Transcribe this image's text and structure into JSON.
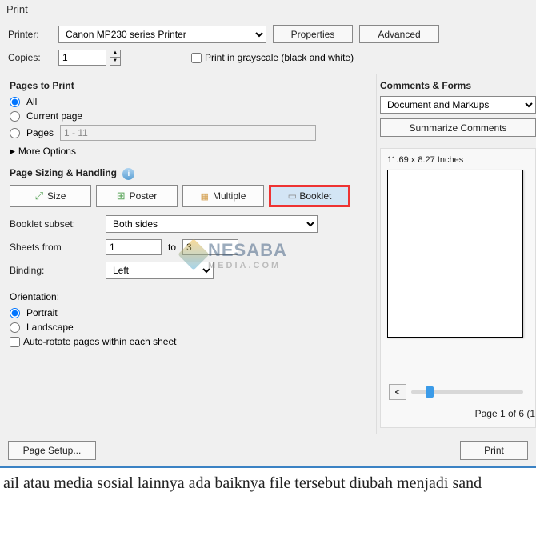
{
  "title": "Print",
  "printer": {
    "label": "Printer:",
    "value": "Canon MP230 series Printer"
  },
  "buttons": {
    "properties": "Properties",
    "advanced": "Advanced",
    "summarize": "Summarize Comments",
    "pagesetup": "Page Setup...",
    "print": "Print"
  },
  "copies": {
    "label": "Copies:",
    "value": "1"
  },
  "grayscale": {
    "label": "Print in grayscale (black and white)"
  },
  "pages_to_print": {
    "title": "Pages to Print",
    "all": "All",
    "current": "Current page",
    "pages": "Pages",
    "range": "1 - 11",
    "more": "More Options"
  },
  "sizing": {
    "title": "Page Sizing & Handling",
    "size": "Size",
    "poster": "Poster",
    "multiple": "Multiple",
    "booklet": "Booklet"
  },
  "booklet_subset": {
    "label": "Booklet subset:",
    "value": "Both sides"
  },
  "sheets": {
    "label": "Sheets from",
    "from": "1",
    "to_label": "to",
    "to": "3"
  },
  "binding": {
    "label": "Binding:",
    "value": "Left"
  },
  "orientation": {
    "title": "Orientation:",
    "portrait": "Portrait",
    "landscape": "Landscape",
    "autorotate": "Auto-rotate pages within each sheet"
  },
  "comments": {
    "title": "Comments & Forms",
    "value": "Document and Markups"
  },
  "preview": {
    "dims": "11.69 x 8.27 Inches",
    "pageinfo": "Page 1 of 6 (1"
  },
  "below": "ail atau media sosial lainnya  ada baiknya file tersebut diubah menjadi sand"
}
